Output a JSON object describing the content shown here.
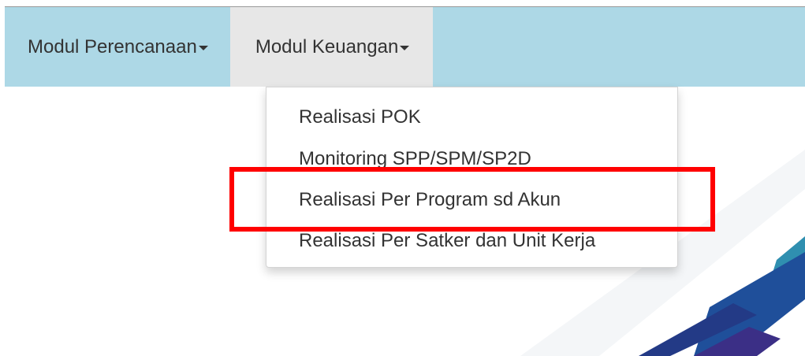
{
  "navbar": {
    "items": [
      {
        "label": "Modul Perencanaan"
      },
      {
        "label": "Modul Keuangan"
      }
    ]
  },
  "dropdown": {
    "items": [
      {
        "label": "Realisasi POK"
      },
      {
        "label": "Monitoring SPP/SPM/SP2D"
      },
      {
        "label": "Realisasi Per Program sd Akun"
      },
      {
        "label": "Realisasi Per Satker dan Unit Kerja"
      }
    ]
  },
  "colors": {
    "navbar_bg": "#add8e6",
    "active_tab_bg": "#e7e7e7",
    "highlight": "#ff0000",
    "text": "#333333"
  }
}
